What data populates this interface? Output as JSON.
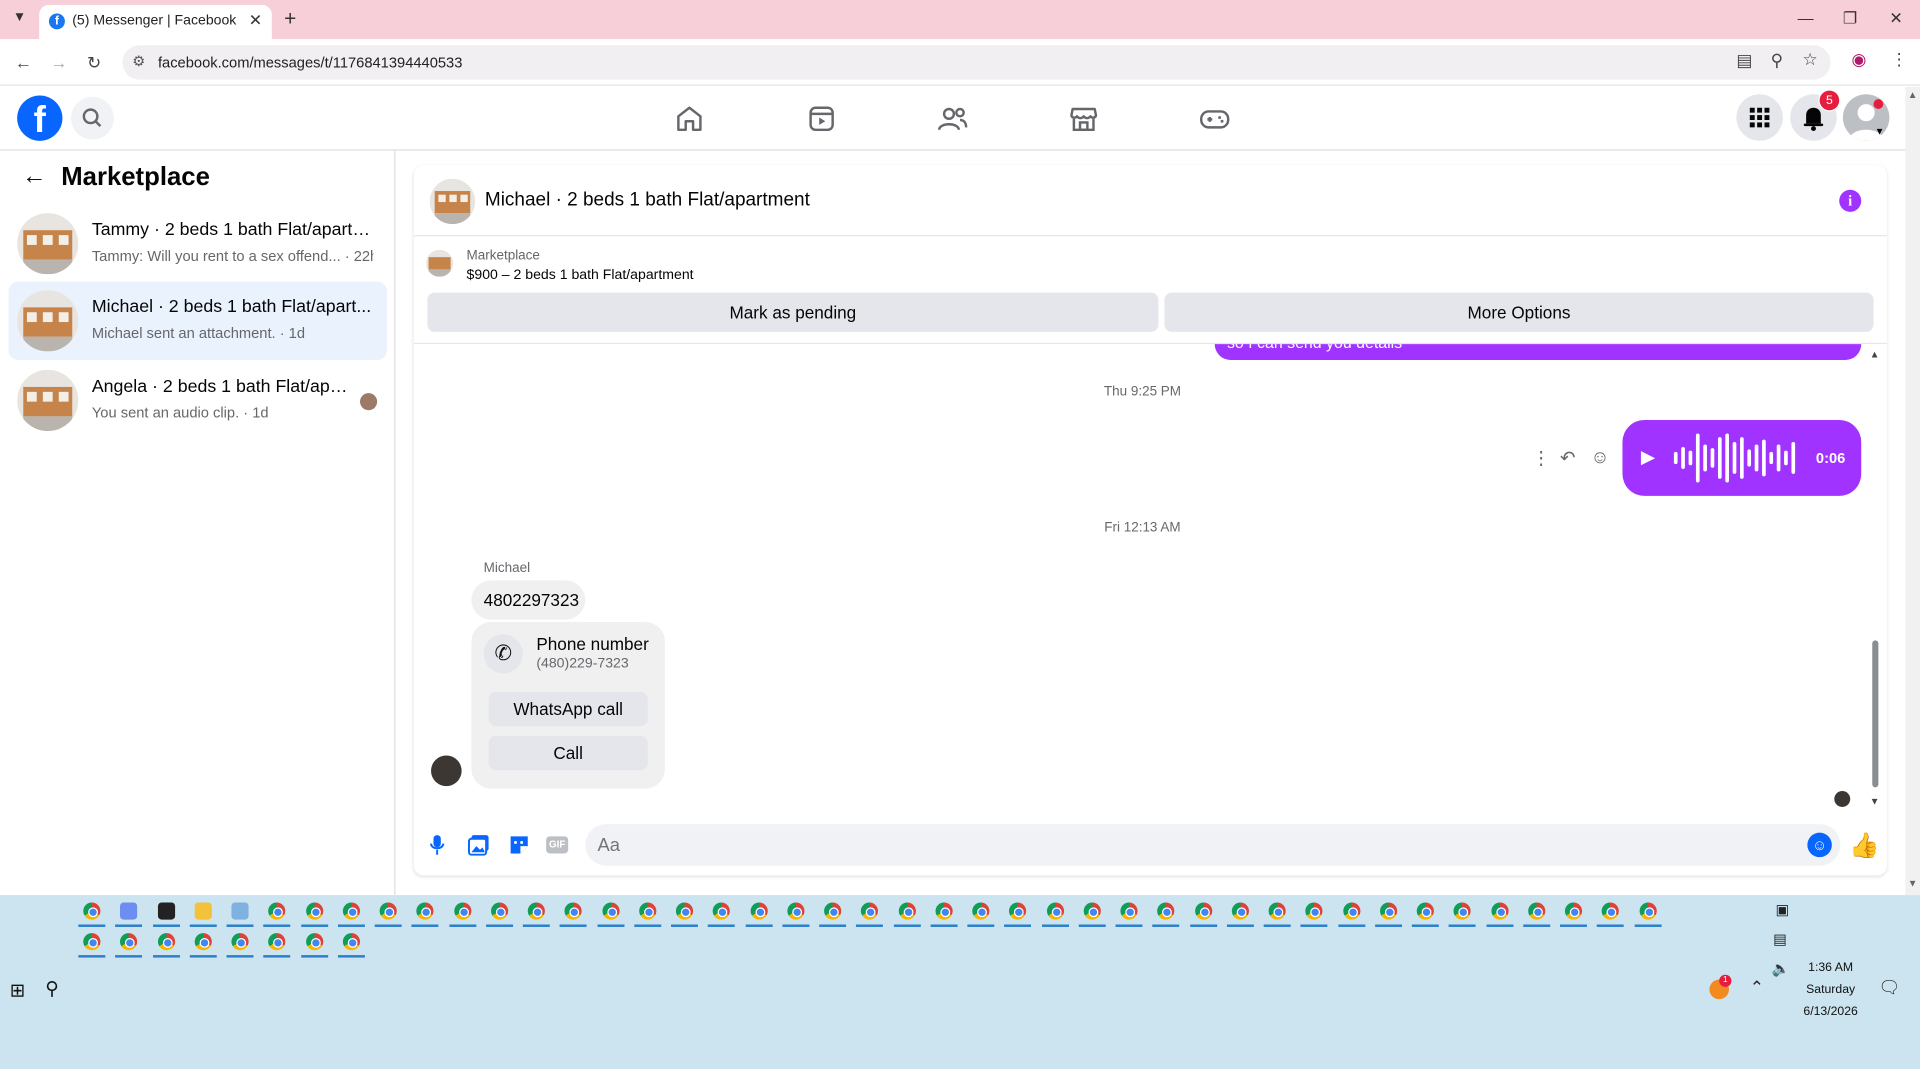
{
  "browser": {
    "tab_title": "(5) Messenger | Facebook",
    "url": "facebook.com/messages/t/1176841394440533"
  },
  "header": {
    "notification_count": "5"
  },
  "left_panel": {
    "title": "Marketplace",
    "conversations": [
      {
        "name": "Tammy · 2 beds 1 bath Flat/apartm...",
        "preview": "Tammy: Will you rent to a sex offend... · 22h",
        "active": false
      },
      {
        "name": "Michael · 2 beds 1 bath Flat/apart...",
        "preview": "Michael sent an attachment. · 1d",
        "active": true
      },
      {
        "name": "Angela · 2 beds 1 bath Flat/apar...",
        "preview": "You sent an audio clip. · 1d",
        "active": false
      }
    ]
  },
  "chat": {
    "title": "Michael · 2 beds 1 bath Flat/apartment",
    "marketplace_label": "Marketplace",
    "listing": "$900 – 2 beds 1 bath Flat/apartment",
    "mark_pending": "Mark as pending",
    "more_options": "More Options",
    "partial_message": "so I can send you details",
    "timestamp_1": "Thu 9:25 PM",
    "audio_duration": "0:06",
    "timestamp_2": "Fri 12:13 AM",
    "sender_name": "Michael",
    "phone_message": "4802297323",
    "phone_card": {
      "title": "Phone number",
      "number": "(480)229-7323",
      "whatsapp_label": "WhatsApp call",
      "call_label": "Call"
    },
    "composer_placeholder": "Aa"
  },
  "taskbar": {
    "time": "1:36 AM",
    "day": "Saturday",
    "date": "6/13/2026",
    "tray_badge": "1"
  },
  "icons": {
    "brand": "#0866ff",
    "messenger_accent": "#a033ff"
  }
}
